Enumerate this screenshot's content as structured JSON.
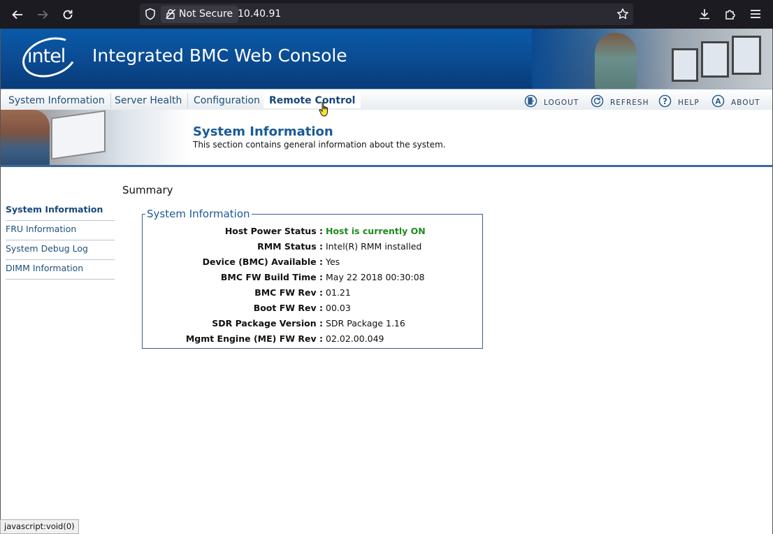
{
  "browser": {
    "security_label": "Not Secure",
    "url": "10.40.91"
  },
  "header": {
    "logo_text": "intel",
    "title": "Integrated BMC Web Console"
  },
  "tabs": [
    {
      "label": "System Information"
    },
    {
      "label": "Server Health"
    },
    {
      "label": "Configuration"
    },
    {
      "label": "Remote Control"
    }
  ],
  "toolbar": {
    "logout": "LOGOUT",
    "refresh": "REFRESH",
    "help": "HELP",
    "about": "ABOUT"
  },
  "section": {
    "title": "System Information",
    "description": "This section contains general information about the system."
  },
  "summary_heading": "Summary",
  "sidenav": [
    {
      "label": "System Information"
    },
    {
      "label": "FRU Information"
    },
    {
      "label": "System Debug Log"
    },
    {
      "label": "DIMM Information"
    }
  ],
  "info": {
    "legend": "System Information",
    "rows": [
      {
        "label": "Host Power Status :",
        "value": "Host is currently ON"
      },
      {
        "label": "RMM Status :",
        "value": "Intel(R) RMM installed"
      },
      {
        "label": "Device (BMC) Available :",
        "value": "Yes"
      },
      {
        "label": "BMC FW Build Time :",
        "value": "May 22 2018 00:30:08"
      },
      {
        "label": "BMC FW Rev :",
        "value": "01.21"
      },
      {
        "label": "Boot FW Rev :",
        "value": "00.03"
      },
      {
        "label": "SDR Package Version :",
        "value": "SDR Package 1.16"
      },
      {
        "label": "Mgmt Engine (ME) FW Rev :",
        "value": "02.02.00.049"
      }
    ]
  },
  "status_bar": "javascript:void(0)",
  "colors": {
    "brand_blue": "#0b4a91",
    "link_blue": "#1f4f7a",
    "power_on_green": "#1f8a1f"
  }
}
